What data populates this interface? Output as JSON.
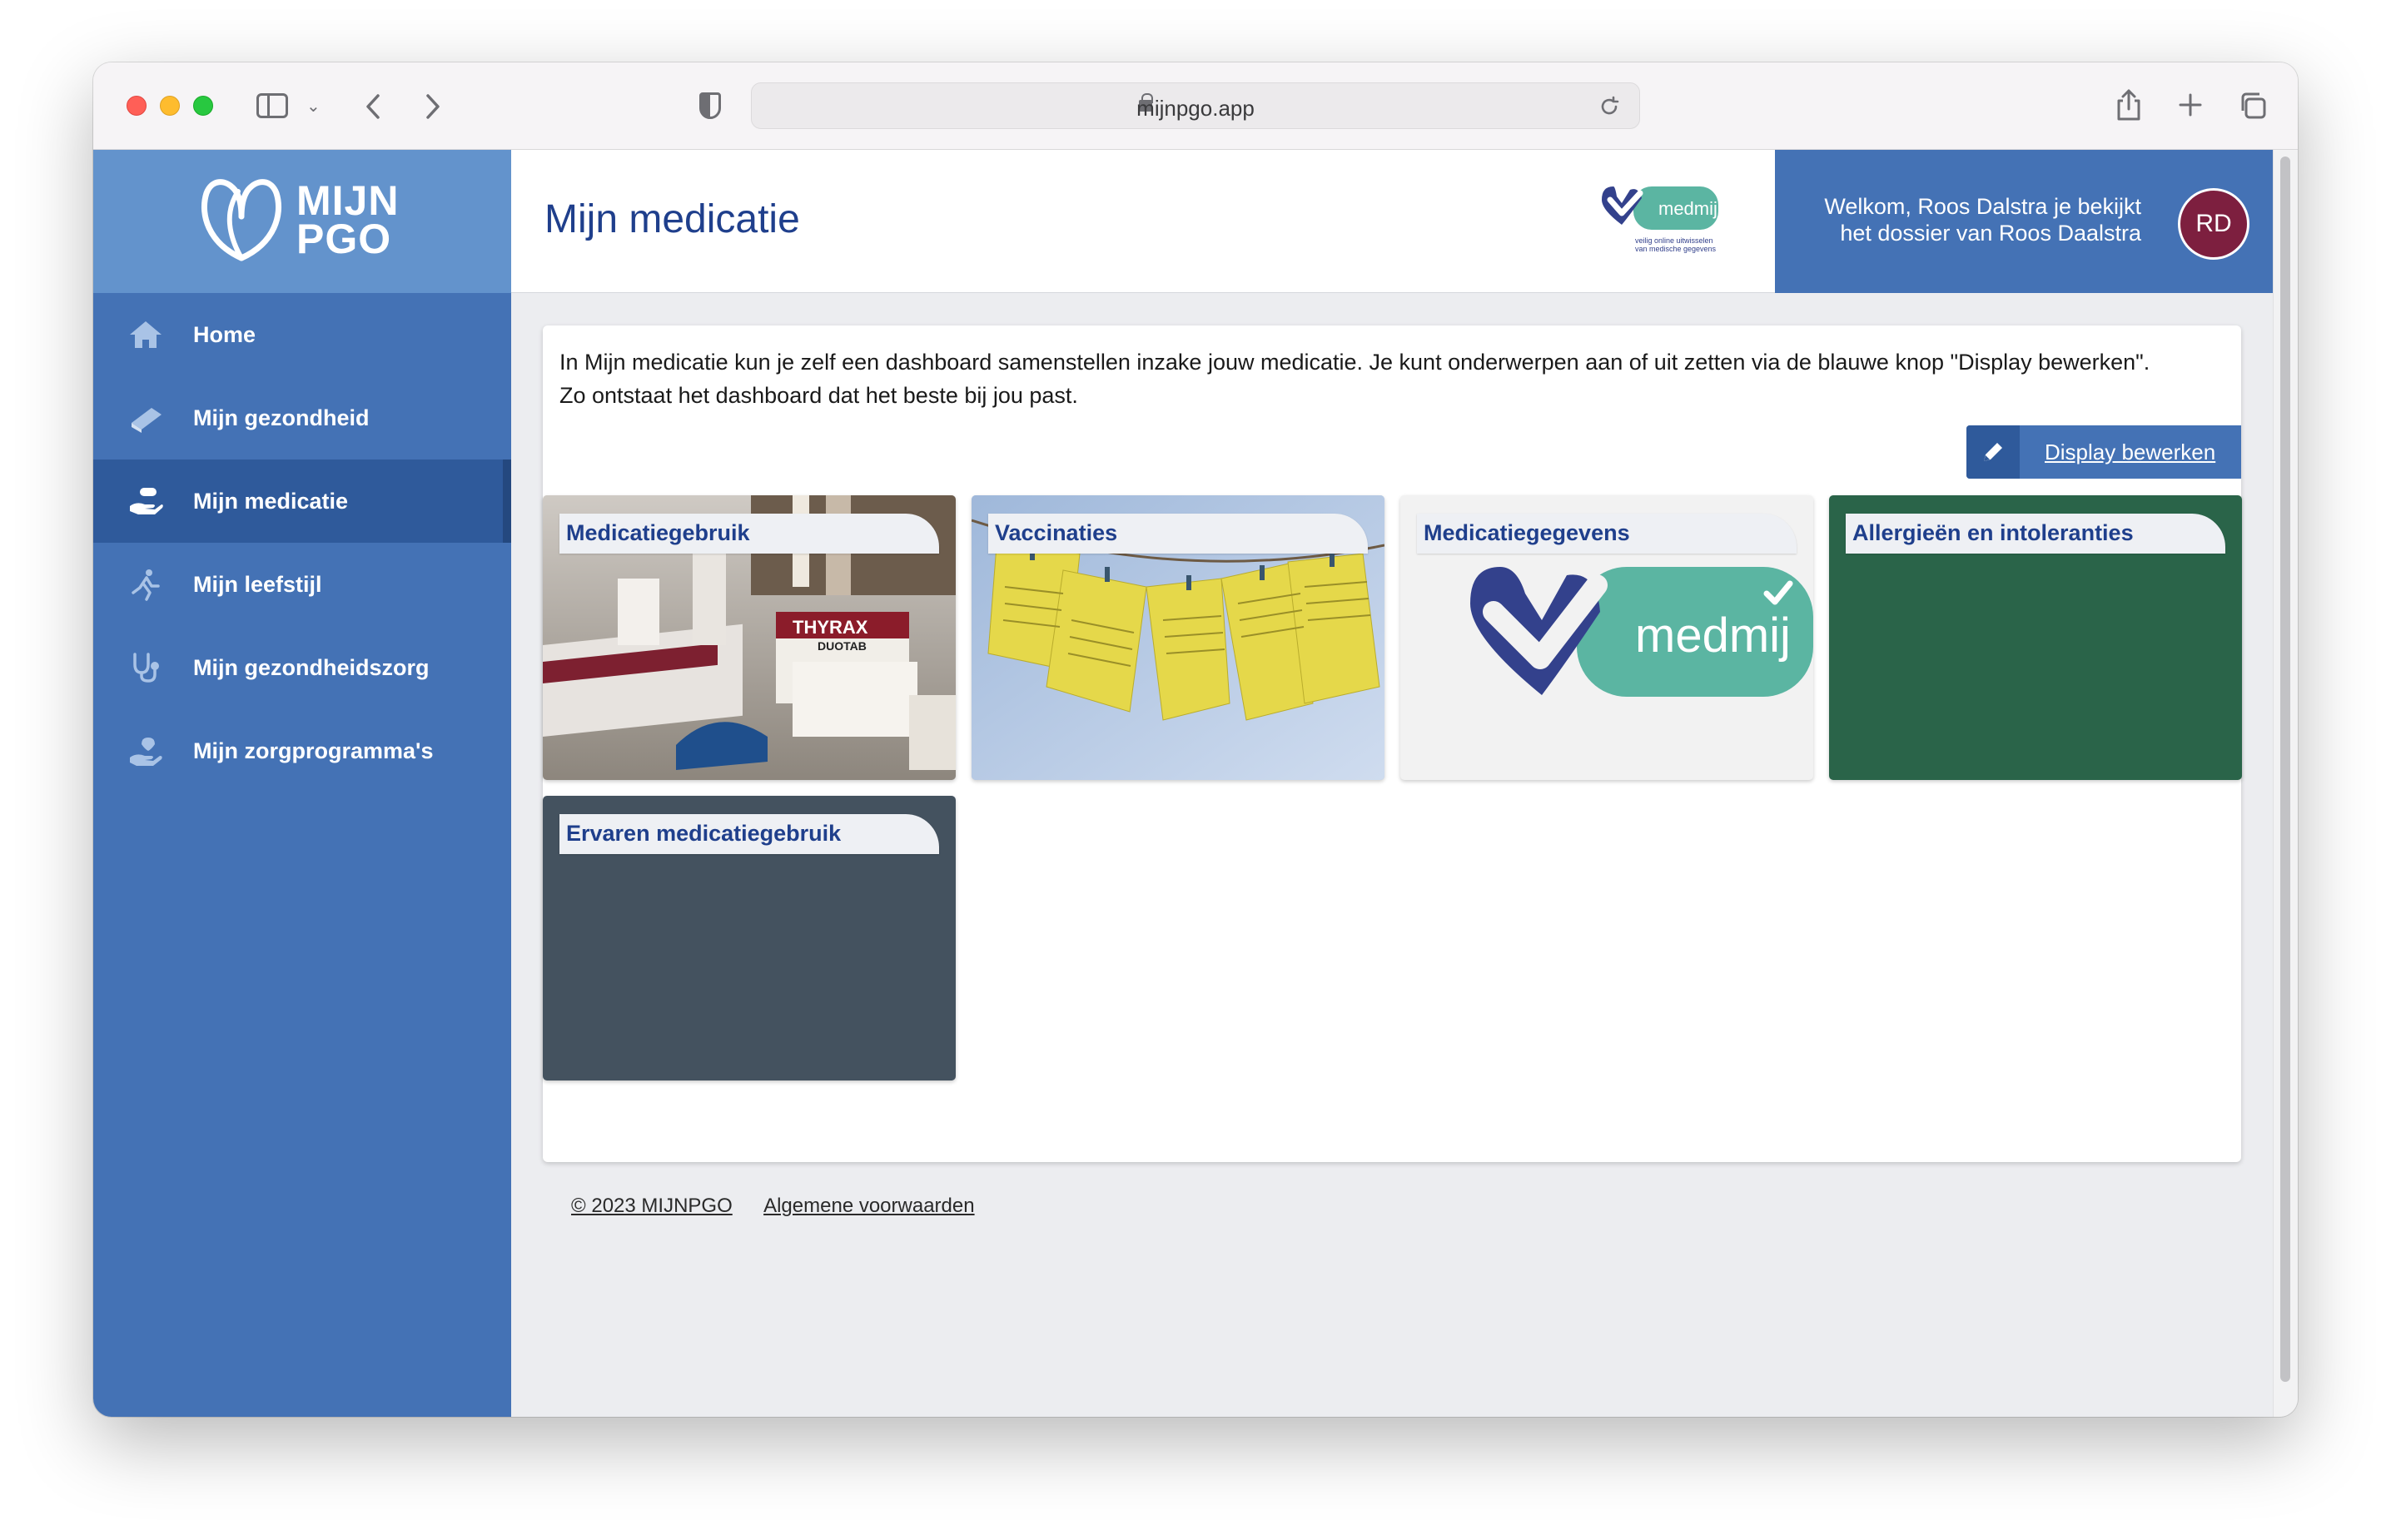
{
  "browser": {
    "url": "mijnpgo.app"
  },
  "brand": {
    "logo_line1": "MIJN",
    "logo_line2": "PGO"
  },
  "sidebar": {
    "items": [
      {
        "label": "Home",
        "icon": "home-icon",
        "active": false
      },
      {
        "label": "Mijn gezondheid",
        "icon": "book-icon",
        "active": false
      },
      {
        "label": "Mijn medicatie",
        "icon": "hand-pill-icon",
        "active": true
      },
      {
        "label": "Mijn leefstijl",
        "icon": "runner-icon",
        "active": false
      },
      {
        "label": "Mijn gezondheidszorg",
        "icon": "stethoscope-icon",
        "active": false
      },
      {
        "label": "Mijn zorgprogramma's",
        "icon": "care-hand-icon",
        "active": false
      }
    ]
  },
  "header": {
    "title": "Mijn medicatie",
    "medmij_text": "medmij",
    "medmij_tagline1": "veilig online uitwisselen",
    "medmij_tagline2": "van medische gegevens",
    "welcome_line1": "Welkom, Roos Dalstra je bekijkt",
    "welcome_line2": "het dossier van Roos Daalstra",
    "avatar_initials": "RD"
  },
  "main": {
    "intro_line1": "In Mijn medicatie kun je zelf een dashboard samenstellen inzake jouw medicatie. Je kunt onderwerpen aan of uit zetten via de blauwe knop \"Display bewerken\".",
    "intro_line2": "Zo ontstaat het dashboard dat het beste bij jou past.",
    "edit_button_label": "Display bewerken",
    "tiles": [
      {
        "label": "Medicatiegebruik",
        "box_text": "THYRAX",
        "box_sub": "DUOTAB"
      },
      {
        "label": "Vaccinaties"
      },
      {
        "label": "Medicatiegegevens",
        "logo_text": "medmij"
      },
      {
        "label": "Allergieën en intoleranties"
      },
      {
        "label": "Ervaren medicatiegebruik"
      }
    ]
  },
  "footer": {
    "copyright": "© 2023 MIJNPGO",
    "terms": "Algemene voorwaarden"
  },
  "colors": {
    "sidebar": "#4472b5",
    "sidebar_active": "#2f5a9b",
    "logo_bg": "#6393cc",
    "title": "#1f3f8c",
    "avatar": "#7d1f3f",
    "tile_green": "#2a6449",
    "tile_slate": "#44525f",
    "medmij_teal": "#5bb5a2",
    "medmij_navy": "#33418c"
  }
}
